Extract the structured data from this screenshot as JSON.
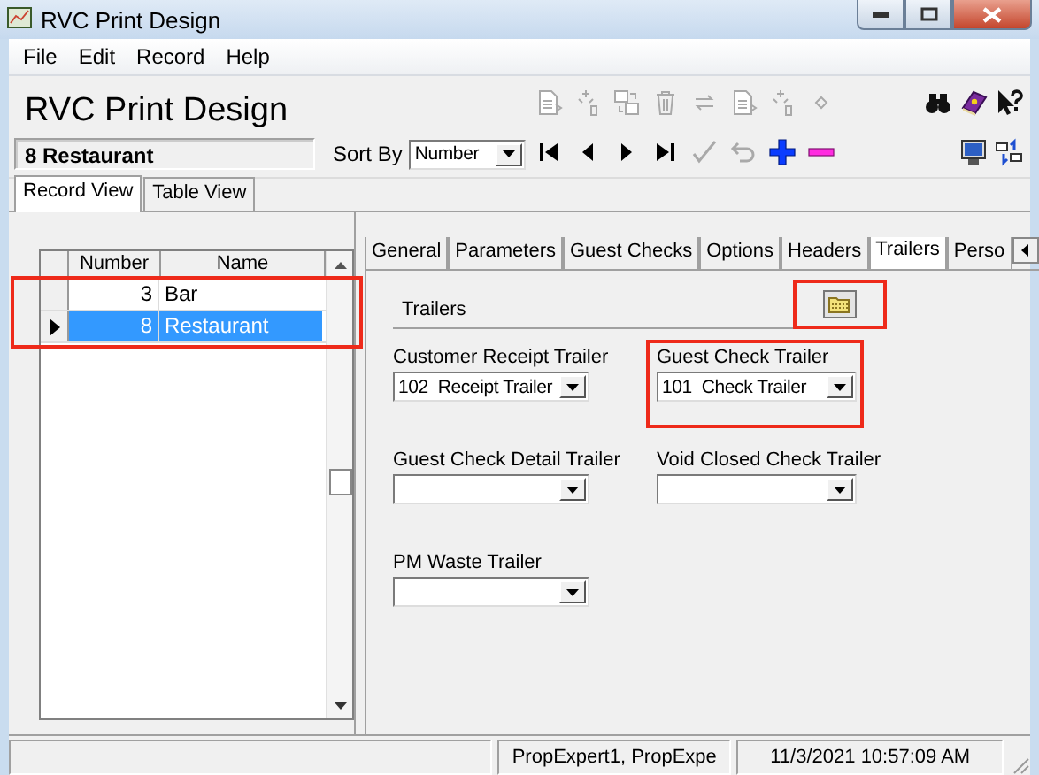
{
  "window": {
    "title": "RVC Print Design"
  },
  "menu": [
    "File",
    "Edit",
    "Record",
    "Help"
  ],
  "header": {
    "title": "RVC Print Design",
    "record": "8 Restaurant",
    "sort_label": "Sort By",
    "sort_value": "Number"
  },
  "toolbar_top": [
    {
      "kind": "page",
      "disabled": true
    },
    {
      "kind": "sparkle",
      "disabled": true
    },
    {
      "kind": "copy",
      "disabled": true
    },
    {
      "kind": "trash",
      "disabled": true
    },
    {
      "kind": "arrows",
      "disabled": true
    },
    {
      "kind": "page",
      "disabled": true
    },
    {
      "kind": "sparkle",
      "disabled": true
    },
    {
      "kind": "diamond",
      "disabled": true
    }
  ],
  "toolbar_bottom": [
    {
      "kind": "first",
      "disabled": false
    },
    {
      "kind": "prev",
      "disabled": false
    },
    {
      "kind": "next",
      "disabled": false
    },
    {
      "kind": "last",
      "disabled": false
    },
    {
      "kind": "check",
      "disabled": true
    },
    {
      "kind": "undo",
      "disabled": true
    },
    {
      "kind": "plus",
      "disabled": false
    },
    {
      "kind": "minus",
      "disabled": false
    }
  ],
  "toolbar_right_top": [
    {
      "kind": "binoculars",
      "disabled": false
    },
    {
      "kind": "book",
      "disabled": false
    },
    {
      "kind": "help",
      "disabled": false
    }
  ],
  "toolbar_right_bottom": [
    {
      "kind": "monitor",
      "disabled": false
    },
    {
      "kind": "swap",
      "disabled": false
    }
  ],
  "view_tabs": [
    {
      "label": "Record View",
      "selected": true
    },
    {
      "label": "Table View",
      "selected": false
    }
  ],
  "grid": {
    "columns": [
      "Number",
      "Name"
    ],
    "highlighted": true,
    "rows": [
      {
        "number": "3",
        "name": "Bar",
        "selected": false
      },
      {
        "number": "8",
        "name": "Restaurant",
        "selected": true
      }
    ]
  },
  "detail_tabs": [
    {
      "label": "General",
      "selected": false
    },
    {
      "label": "Parameters",
      "selected": false
    },
    {
      "label": "Guest Checks",
      "selected": false
    },
    {
      "label": "Options",
      "selected": false
    },
    {
      "label": "Headers",
      "selected": false
    },
    {
      "label": "Trailers",
      "selected": true
    },
    {
      "label": "Perso",
      "selected": false
    }
  ],
  "trailers": {
    "title": "Trailers",
    "browse_highlighted": true,
    "fields": [
      {
        "label": "Customer Receipt Trailer",
        "value": "102  Receipt Trailer",
        "highlighted": false
      },
      {
        "label": "Guest Check Trailer",
        "value": "101  Check Trailer",
        "highlighted": true
      },
      {
        "label": "Guest Check Detail Trailer",
        "highlighted": false
      },
      {
        "label": "Void Closed Check Trailer",
        "highlighted": false
      },
      {
        "label": "PM Waste Trailer",
        "highlighted": false
      }
    ]
  },
  "status_bar": {
    "user": "PropExpert1, PropExpe",
    "time": "11/3/2021 10:57:09 AM"
  }
}
